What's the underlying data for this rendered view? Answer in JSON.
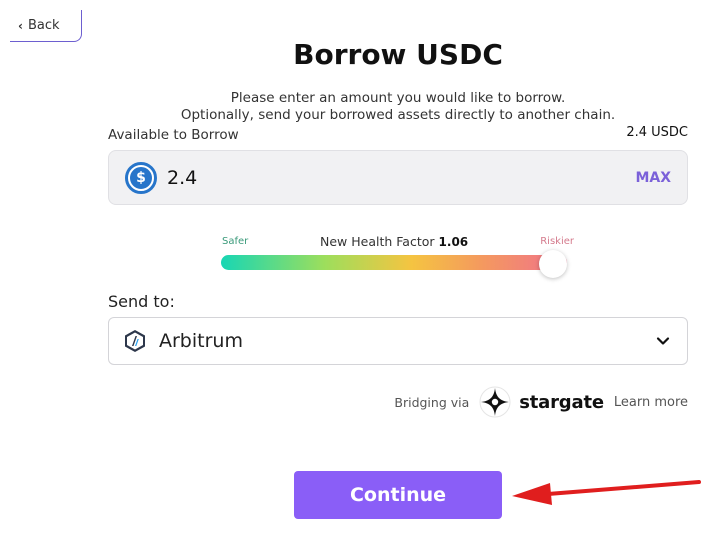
{
  "nav": {
    "back_label": "Back"
  },
  "page": {
    "title": "Borrow USDC",
    "subtitle_line1": "Please enter an amount you would like to borrow.",
    "subtitle_line2": "Optionally, send your borrowed assets directly to another chain."
  },
  "borrow": {
    "available_label": "Available to Borrow",
    "available_value": "2.4 USDC",
    "amount": "2.4",
    "asset_icon": "usdc-icon",
    "max_label": "MAX"
  },
  "health_factor": {
    "label": "New Health Factor",
    "value": "1.06",
    "safer_label": "Safer",
    "riskier_label": "Riskier",
    "level": 0.96
  },
  "send_to": {
    "label": "Send to:",
    "chain": "Arbitrum",
    "chain_icon": "arbitrum-icon"
  },
  "bridge": {
    "via_label": "Bridging via",
    "provider": "stargate",
    "learn_more": "Learn more"
  },
  "actions": {
    "continue_label": "Continue"
  },
  "colors": {
    "accent": "#8a5ef7",
    "max": "#7b61d9",
    "usdc": "#2775ca",
    "annotation_arrow": "#e01e1e"
  }
}
